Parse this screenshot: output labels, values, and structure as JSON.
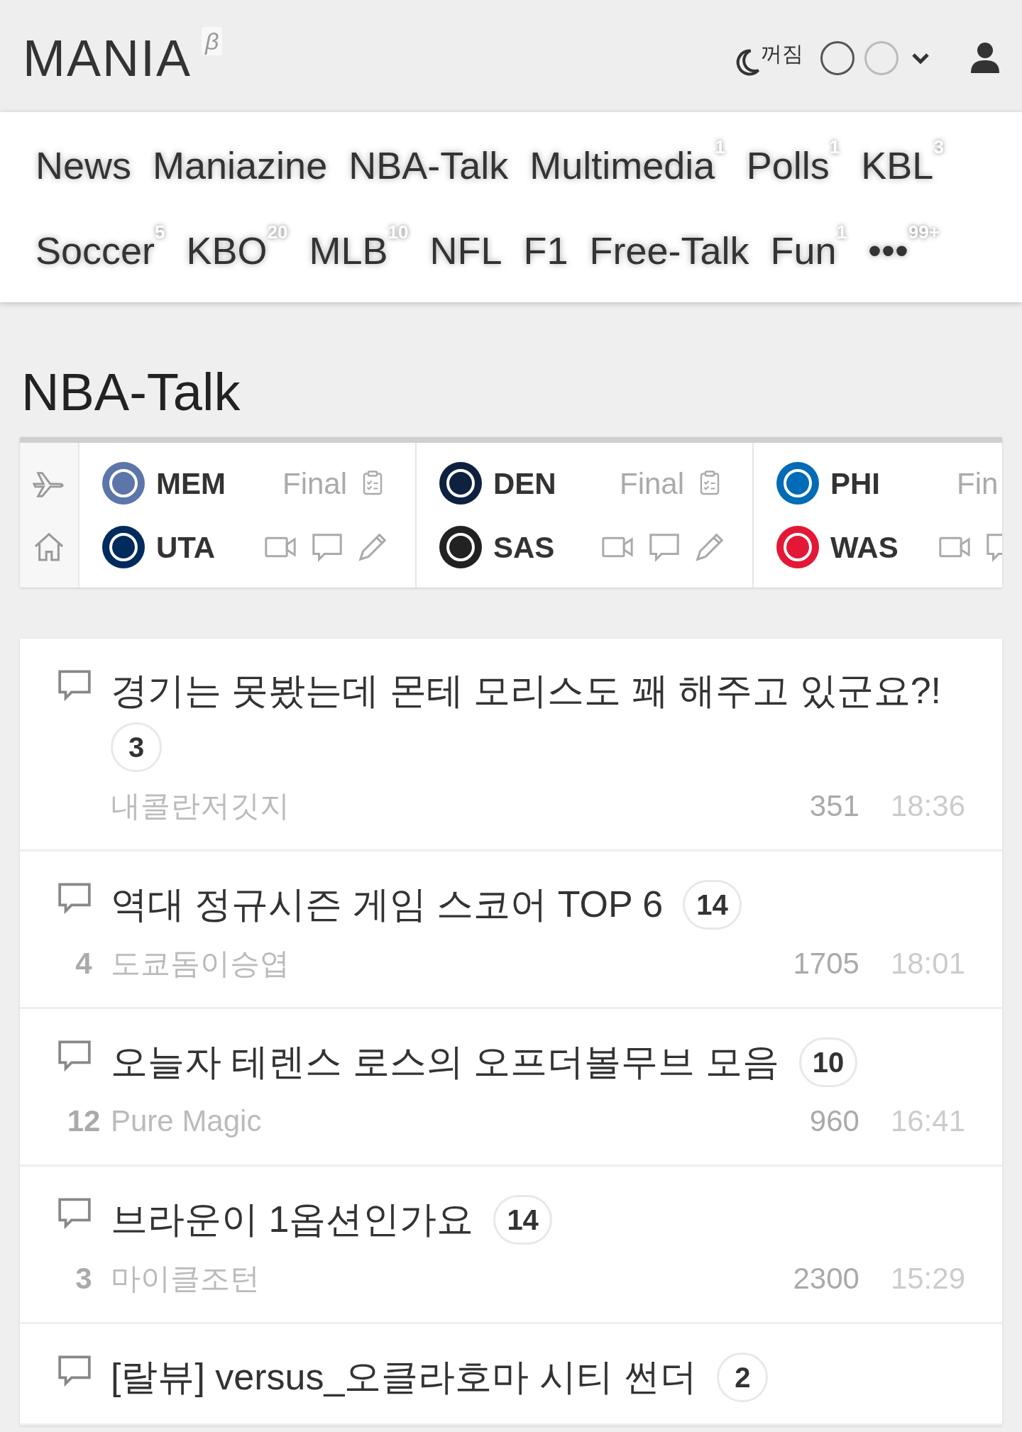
{
  "header": {
    "logo": "MANIA",
    "beta": "β",
    "dark_mode": "꺼짐",
    "theme_swatches": [
      {
        "color": "#555555"
      },
      {
        "color": "#bbbbbb"
      }
    ]
  },
  "nav": [
    {
      "label": "News"
    },
    {
      "label": "Maniazine"
    },
    {
      "label": "NBA-Talk"
    },
    {
      "label": "Multimedia",
      "count": "1"
    },
    {
      "label": "Polls",
      "count": "1"
    },
    {
      "label": "KBL",
      "count": "3"
    },
    {
      "label": "Soccer",
      "count": "5"
    },
    {
      "label": "KBO",
      "count": "20"
    },
    {
      "label": "MLB",
      "count": "10"
    },
    {
      "label": "NFL"
    },
    {
      "label": "F1"
    },
    {
      "label": "Free-Talk"
    },
    {
      "label": "Fun",
      "count": "1"
    },
    {
      "label": "•••",
      "count": "99+"
    }
  ],
  "page_title": "NBA-Talk",
  "games": [
    {
      "status": "Final",
      "teams": [
        {
          "abbr": "MEM",
          "color": "#5d76a9"
        },
        {
          "abbr": "UTA",
          "color": "#002b5c"
        }
      ]
    },
    {
      "status": "Final",
      "teams": [
        {
          "abbr": "DEN",
          "color": "#0e2240"
        },
        {
          "abbr": "SAS",
          "color": "#222222"
        }
      ]
    },
    {
      "status": "Fin",
      "cut_off": true,
      "teams": [
        {
          "abbr": "PHI",
          "color": "#006bb6"
        },
        {
          "abbr": "WAS",
          "color": "#e31837"
        }
      ]
    }
  ],
  "posts": [
    {
      "title": "경기는 못봤는데 몬테 모리스도 꽤 해주고 있군요?!",
      "comments": "3",
      "author": "내콜란저깃지",
      "views": "351",
      "time": "18:36"
    },
    {
      "title": "역대 정규시즌 게임 스코어 TOP 6",
      "comments": "14",
      "votes": "4",
      "author": "도쿄돔이승엽",
      "views": "1705",
      "time": "18:01"
    },
    {
      "title": "오늘자 테렌스 로스의 오프더볼무브 모음",
      "comments": "10",
      "votes": "12",
      "author": "Pure Magic",
      "views": "960",
      "time": "16:41"
    },
    {
      "title": "브라운이 1옵션인가요",
      "comments": "14",
      "votes": "3",
      "author": "마이클조턴",
      "views": "2300",
      "time": "15:29"
    },
    {
      "title": "[랄뷰] versus_오클라호마 시티 썬더",
      "comments": "2"
    }
  ]
}
